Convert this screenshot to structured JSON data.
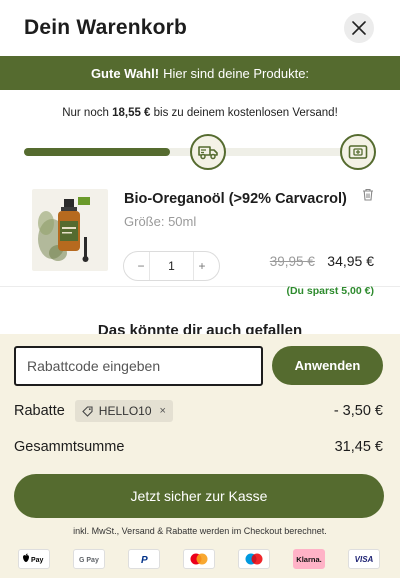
{
  "header": {
    "title": "Dein Warenkorb",
    "close_icon": "close-icon"
  },
  "banner": {
    "bold": "Gute Wahl!",
    "text": "Hier sind deine Produkte:"
  },
  "shipping": {
    "prefix": "Nur noch",
    "amount": "18,55 €",
    "suffix": "bis zu deinem kostenlosen Versand!",
    "progress": 0.43,
    "milestone_icons": [
      "truck-icon",
      "gift-card-icon"
    ]
  },
  "product": {
    "name": "Bio-Oreganoöl (>92% Carvacrol)",
    "size": "Größe: 50ml",
    "quantity": "1",
    "minus": "−",
    "plus": "+",
    "old_price": "39,95 €",
    "new_price": "34,95 €",
    "savings": "(Du sparst 5,00 €)"
  },
  "teaser": "Das könnte dir auch gefallen",
  "coupon": {
    "placeholder": "Rabattcode eingeben",
    "apply_label": "Anwenden"
  },
  "discount": {
    "label": "Rabatte",
    "code": "HELLO10",
    "remove": "×",
    "amount": "- 3,50 €"
  },
  "total": {
    "label": "Gesammtsumme",
    "amount": "31,45 €"
  },
  "checkout": {
    "label": "Jetzt sicher zur Kasse"
  },
  "fine_print": "inkl. MwSt., Versand & Rabatte werden im Checkout berechnet.",
  "payments": [
    {
      "name": "apple-pay",
      "label": "Pay"
    },
    {
      "name": "google-pay",
      "label": "G Pay"
    },
    {
      "name": "paypal",
      "label": "P"
    },
    {
      "name": "mastercard",
      "label": ""
    },
    {
      "name": "maestro",
      "label": ""
    },
    {
      "name": "klarna",
      "label": "Klarna."
    },
    {
      "name": "visa",
      "label": "VISA"
    }
  ],
  "colors": {
    "accent": "#556b2f",
    "bottom_bg": "#f6f2e2",
    "savings": "#2e8b2e"
  }
}
